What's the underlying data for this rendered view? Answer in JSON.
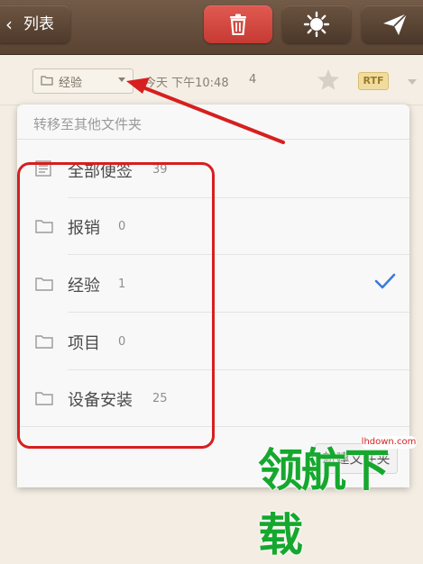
{
  "toolbar": {
    "back_label": "列表",
    "icons": [
      "trash-icon",
      "sun-icon",
      "send-icon"
    ],
    "delete_color": "#d9473f"
  },
  "note_meta": {
    "folder": "经验",
    "date": "今天 下午10:48",
    "count": "4",
    "badge": "RTF"
  },
  "popover": {
    "title": "转移至其他文件夹",
    "folders": [
      {
        "name": "全部便签",
        "count": "39",
        "icon": "note-icon"
      },
      {
        "name": "报销",
        "count": "0",
        "icon": "folder-icon"
      },
      {
        "name": "经验",
        "count": "1",
        "icon": "folder-icon",
        "selected": true
      },
      {
        "name": "项目",
        "count": "0",
        "icon": "folder-icon"
      },
      {
        "name": "设备安装",
        "count": "25",
        "icon": "folder-icon"
      }
    ],
    "new_folder_label": "新建文件夹",
    "check_color": "#3d7bd9"
  },
  "watermark": {
    "text": "领航下载",
    "url": "lhdown.com"
  },
  "annotation_color": "#d61f1f"
}
